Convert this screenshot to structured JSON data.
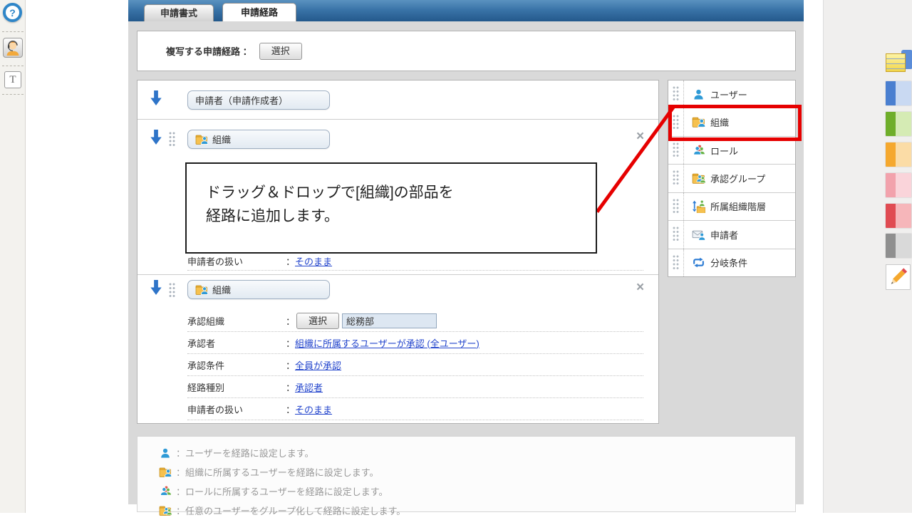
{
  "colon": "：",
  "colors": {
    "accent_red": "#e60000",
    "link_blue": "#2244cc",
    "bar_blue": "#2a6094",
    "person_blue": "#2f9ad6",
    "folder_yellow": "#f6c14e"
  },
  "left_rail": {
    "items": [
      {
        "icon": "help-icon",
        "glyph": "?"
      },
      {
        "icon": "operator-icon"
      },
      {
        "icon": "text-tool-icon",
        "label": "T"
      }
    ]
  },
  "tabs": {
    "inactive": "申請書式",
    "active": "申請経路"
  },
  "copy_route": {
    "label": "複写する申請経路",
    "button": "選択"
  },
  "flow": {
    "applicant_button": "申請者（申請作成者）",
    "close_glyph": "×",
    "row_arrow_icon": "down-arrow-icon",
    "drag_handle_icon": "drag-handle",
    "blocks": [
      {
        "button": "組織",
        "icon": "org-icon",
        "fields": [
          {
            "label": "申請者の扱い",
            "value": "そのまま"
          }
        ]
      },
      {
        "button": "組織",
        "icon": "org-icon",
        "fields": [
          {
            "label": "承認組織",
            "button": "選択",
            "input": "総務部"
          },
          {
            "label": "承認者",
            "value": "組織に所属するユーザーが承認 (全ユーザー)"
          },
          {
            "label": "承認条件",
            "value": "全員が承認"
          },
          {
            "label": "経路種別",
            "value": "承認者"
          },
          {
            "label": "申請者の扱い",
            "value": "そのまま"
          }
        ]
      }
    ]
  },
  "palette": {
    "items": [
      {
        "icon": "user-icon",
        "label": "ユーザー"
      },
      {
        "icon": "org-icon",
        "label": "組織"
      },
      {
        "icon": "role-icon",
        "label": "ロール"
      },
      {
        "icon": "approval-group-icon",
        "label": "承認グループ"
      },
      {
        "icon": "org-hierarchy-icon",
        "label": "所属組織階層"
      },
      {
        "icon": "applicant-icon",
        "label": "申請者"
      },
      {
        "icon": "branch-condition-icon",
        "label": "分岐条件"
      }
    ]
  },
  "callout": {
    "line1": "ドラッグ＆ドロップで[組織]の部品を",
    "line2": "経路に追加します。"
  },
  "legend": {
    "items": [
      {
        "icon": "user-icon",
        "text": "：ユーザーを経路に設定します。"
      },
      {
        "icon": "org-icon",
        "text": "：組織に所属するユーザーを経路に設定します。"
      },
      {
        "icon": "role-icon",
        "text": "：ロールに所属するユーザーを経路に設定します。"
      },
      {
        "icon": "approval-group-icon",
        "text": "：任意のユーザーをグループ化して経路に設定します。"
      }
    ]
  },
  "right_toolbar": {
    "items": [
      {
        "icon": "sticky-note-icon"
      },
      {
        "icon": "blue-note-swatch",
        "color": "#4a7fd0",
        "light": "#c9d9f2"
      },
      {
        "icon": "green-note-swatch",
        "color": "#6fae2a",
        "light": "#d5ebb4"
      },
      {
        "icon": "orange-note-swatch",
        "color": "#f5a82e",
        "light": "#fbdca6"
      },
      {
        "icon": "pink-note-swatch",
        "color": "#f2a2ac",
        "light": "#fad4da"
      },
      {
        "icon": "red-note-swatch",
        "color": "#e04b52",
        "light": "#f6b6ba"
      },
      {
        "icon": "grey-note-swatch",
        "color": "#8f8f8f",
        "light": "#d9d9d9"
      },
      {
        "icon": "pencil-icon"
      }
    ]
  }
}
